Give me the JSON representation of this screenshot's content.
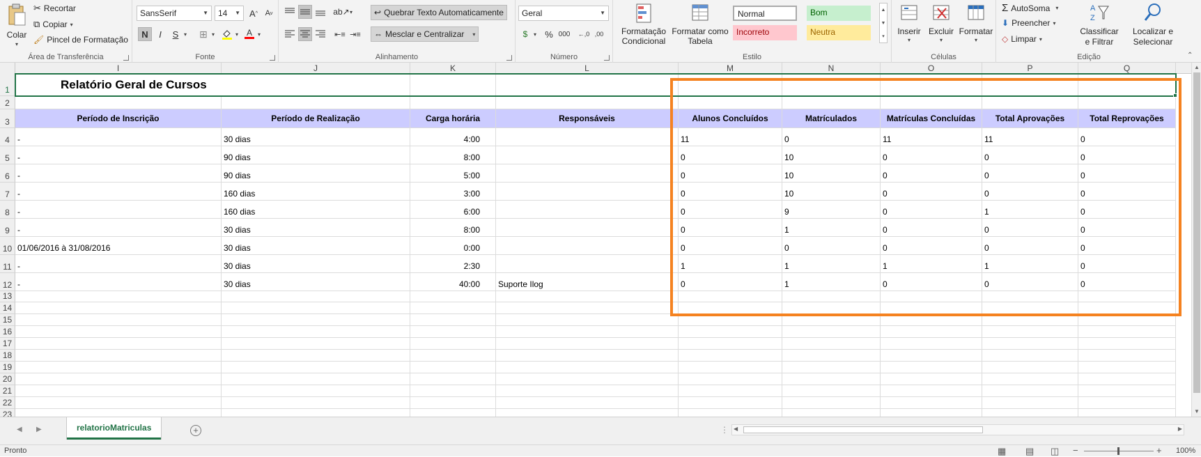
{
  "ribbon": {
    "clipboard": {
      "paste_label": "Colar",
      "cut_label": "Recortar",
      "copy_label": "Copiar",
      "format_painter_label": "Pincel de Formatação",
      "group_label": "Área de Transferência"
    },
    "font": {
      "font_name": "SansSerif",
      "font_size": "14",
      "bold_label": "N",
      "italic_label": "I",
      "underline_label": "S",
      "group_label": "Fonte"
    },
    "alignment": {
      "wrap_text_label": "Quebrar Texto Automaticamente",
      "merge_center_label": "Mesclar e Centralizar",
      "group_label": "Alinhamento"
    },
    "number": {
      "format": "Geral",
      "percent_label": "%",
      "thousands_label": "000",
      "group_label": "Número"
    },
    "styles": {
      "conditional_label": "Formatação Condicional",
      "format_table_label": "Formatar como Tabela",
      "normal_label": "Normal",
      "good_label": "Bom",
      "bad_label": "Incorreto",
      "neutral_label": "Neutra",
      "group_label": "Estilo"
    },
    "cells": {
      "insert_label": "Inserir",
      "delete_label": "Excluir",
      "format_label": "Formatar",
      "group_label": "Células"
    },
    "editing": {
      "autosum_label": "AutoSoma",
      "fill_label": "Preencher",
      "clear_label": "Limpar",
      "sort_filter_label": "Classificar e Filtrar",
      "find_select_label": "Localizar e Selecionar",
      "group_label": "Edição"
    }
  },
  "sheet": {
    "columns": [
      "I",
      "J",
      "K",
      "L",
      "M",
      "N",
      "O",
      "P",
      "Q"
    ],
    "rows": [
      "1",
      "2",
      "3",
      "4",
      "5",
      "6",
      "7",
      "8",
      "9",
      "10",
      "11",
      "12",
      "13",
      "14",
      "15",
      "16",
      "17",
      "18",
      "19",
      "20",
      "21",
      "22",
      "23"
    ],
    "title": "Relatório Geral de Cursos",
    "headers": [
      "Período de Inscrição",
      "Período de Realização",
      "Carga horária",
      "Responsáveis",
      "Alunos Concluídos",
      "Matrículados",
      "Matrículas Concluídas",
      "Total Aprovações",
      "Total Reprovações"
    ],
    "data": [
      [
        "-",
        "30 dias",
        "4:00",
        "",
        "11",
        "0",
        "11",
        "11",
        "0"
      ],
      [
        "-",
        "90 dias",
        "8:00",
        "",
        "0",
        "10",
        "0",
        "0",
        "0"
      ],
      [
        "-",
        "90 dias",
        "5:00",
        "",
        "0",
        "10",
        "0",
        "0",
        "0"
      ],
      [
        "-",
        "160 dias",
        "3:00",
        "",
        "0",
        "10",
        "0",
        "0",
        "0"
      ],
      [
        "-",
        "160 dias",
        "6:00",
        "",
        "0",
        "9",
        "0",
        "1",
        "0"
      ],
      [
        "-",
        "30 dias",
        "8:00",
        "",
        "0",
        "1",
        "0",
        "0",
        "0"
      ],
      [
        "01/06/2016 à 31/08/2016",
        "30 dias",
        "0:00",
        "",
        "0",
        "0",
        "0",
        "0",
        "0"
      ],
      [
        "-",
        "30 dias",
        "2:30",
        "",
        "1",
        "1",
        "1",
        "1",
        "0"
      ],
      [
        "-",
        "30 dias",
        "40:00",
        "Suporte Ilog",
        "0",
        "1",
        "0",
        "0",
        "0"
      ]
    ],
    "header_fill": "#ccccff",
    "highlight_color": "#f58220"
  },
  "tabs": {
    "active_sheet": "relatorioMatriculas"
  },
  "status": {
    "ready_text": "Pronto",
    "zoom_text": "100%"
  }
}
